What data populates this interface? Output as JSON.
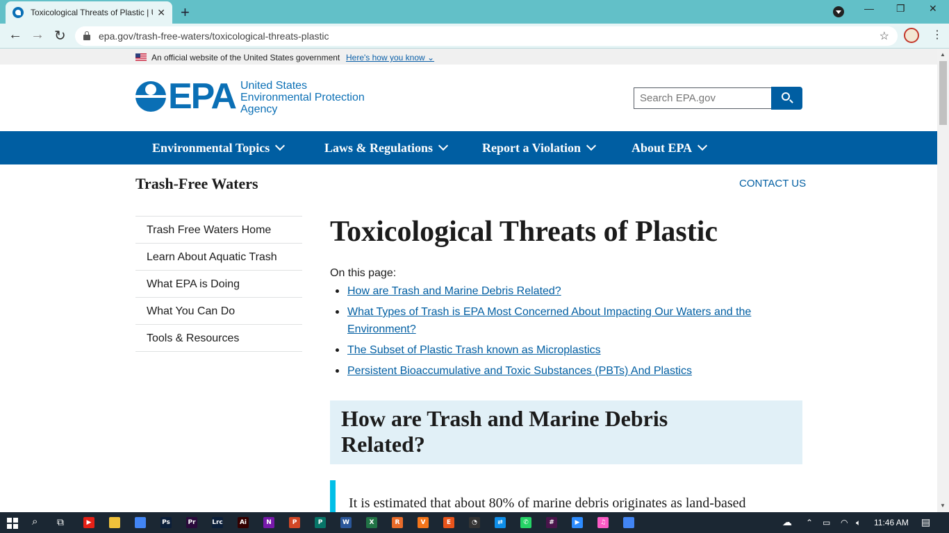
{
  "browser": {
    "tab_title": "Toxicological Threats of Plastic | U",
    "tab_close": "✕",
    "new_tab": "+",
    "url": "epa.gov/trash-free-waters/toxicological-threats-plastic",
    "back": "←",
    "forward": "→",
    "reload": "↻",
    "star": "☆",
    "minimize": "—",
    "restore": "❐",
    "close": "✕",
    "menu": "⋮"
  },
  "gov_banner": {
    "text": "An official website of the United States government",
    "link": "Here's how you know ⌄"
  },
  "header": {
    "logo_text": "EPA",
    "agency_line1": "United States",
    "agency_line2": "Environmental Protection",
    "agency_line3": "Agency",
    "search_placeholder": "Search EPA.gov"
  },
  "main_nav": [
    {
      "label": "Environmental Topics"
    },
    {
      "label": "Laws & Regulations"
    },
    {
      "label": "Report a Violation"
    },
    {
      "label": "About EPA"
    }
  ],
  "section": {
    "title": "Trash-Free Waters",
    "contact": "CONTACT US"
  },
  "sidenav": [
    {
      "label": "Trash Free Waters Home"
    },
    {
      "label": "Learn About Aquatic Trash"
    },
    {
      "label": "What EPA is Doing"
    },
    {
      "label": "What You Can Do"
    },
    {
      "label": "Tools & Resources"
    }
  ],
  "content": {
    "h1": "Toxicological Threats of Plastic",
    "on_this_page": "On this page:",
    "toc": [
      {
        "line1": "How are Trash and Marine Debris Related?",
        "line2": ""
      },
      {
        "line1": "What Types of Trash is EPA Most Concerned About Impacting Our Waters and the",
        "line2": "Environment?"
      },
      {
        "line1": "The Subset of Plastic Trash known as Microplastics",
        "line2": ""
      },
      {
        "line1": "Persistent Bioaccumulative and Toxic Substances (PBTs) And Plastics",
        "line2": ""
      }
    ],
    "h2_line1": "How are Trash and Marine Debris",
    "h2_line2": "Related?",
    "body": "It is estimated that about 80% of marine debris originates as land-based"
  },
  "taskbar": {
    "time": "11:46 AM",
    "apps": [
      {
        "name": "youtube",
        "label": "▶",
        "color": "#e62117"
      },
      {
        "name": "file-explorer",
        "label": "",
        "color": "#f0c23b"
      },
      {
        "name": "chrome",
        "label": "",
        "color": "#4285f4"
      },
      {
        "name": "photoshop",
        "label": "Ps",
        "color": "#0b1f3a"
      },
      {
        "name": "premiere",
        "label": "Pr",
        "color": "#2a0a3b"
      },
      {
        "name": "lightroom-classic",
        "label": "Lrc",
        "color": "#0b1f3a"
      },
      {
        "name": "illustrator",
        "label": "Ai",
        "color": "#330000"
      },
      {
        "name": "onenote",
        "label": "N",
        "color": "#7719aa"
      },
      {
        "name": "powerpoint",
        "label": "P",
        "color": "#d24726"
      },
      {
        "name": "publisher",
        "label": "P",
        "color": "#077568"
      },
      {
        "name": "word",
        "label": "W",
        "color": "#2b579a"
      },
      {
        "name": "excel",
        "label": "X",
        "color": "#217346"
      },
      {
        "name": "app-r",
        "label": "R",
        "color": "#e86b2a"
      },
      {
        "name": "app-v",
        "label": "V",
        "color": "#f4751a"
      },
      {
        "name": "app-e",
        "label": "E",
        "color": "#e9541b"
      },
      {
        "name": "app-circle",
        "label": "◔",
        "color": "#333"
      },
      {
        "name": "teamviewer",
        "label": "⇄",
        "color": "#0e8ee9"
      },
      {
        "name": "whatsapp",
        "label": "✆",
        "color": "#25d366"
      },
      {
        "name": "slack",
        "label": "#",
        "color": "#4a154b"
      },
      {
        "name": "zoom",
        "label": "▶",
        "color": "#2d8cff"
      },
      {
        "name": "itunes",
        "label": "♫",
        "color": "#fb5bc5"
      },
      {
        "name": "chrome-active",
        "label": "",
        "color": "#4285f4"
      }
    ]
  }
}
